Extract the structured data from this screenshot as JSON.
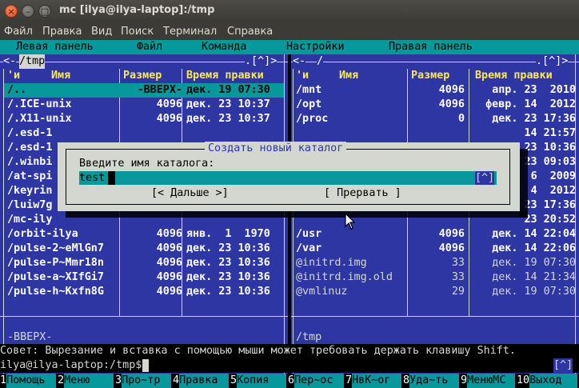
{
  "window": {
    "title": "mc [ilya@ilya-laptop]:/tmp"
  },
  "menubar": [
    "Файл",
    "Правка",
    "Вид",
    "Поиск",
    "Терминал",
    "Справка"
  ],
  "mc_menu": [
    "Левая панель",
    "Файл",
    "Команда",
    "Настройки",
    "Правая панель"
  ],
  "left_panel": {
    "path": "/tmp",
    "corner": ".[^]>",
    "sort_indicator": "'и",
    "headers": {
      "name": "Имя",
      "size": "Размер",
      "time": "Время правки"
    },
    "rows": [
      {
        "name": "/..",
        "size": "-ВВЕРХ-",
        "time": "дек. 19 07:30",
        "selected": true
      },
      {
        "name": "/.ICE-unix",
        "size": "4096",
        "time": "дек. 23 10:37"
      },
      {
        "name": "/.X11-unix",
        "size": "4096",
        "time": "дек. 23 10:37"
      },
      {
        "name": "/.esd-1",
        "size": "",
        "time": ""
      },
      {
        "name": "/.esd-1",
        "size": "",
        "time": ""
      },
      {
        "name": "/.winbi",
        "size": "",
        "time": ""
      },
      {
        "name": "/at-spi",
        "size": "",
        "time": ""
      },
      {
        "name": "/keyrin",
        "size": "",
        "time": ""
      },
      {
        "name": "/luiw7g",
        "size": "",
        "time": ""
      },
      {
        "name": "/mc-ily",
        "size": "",
        "time": ""
      },
      {
        "name": "/orbit-ilya",
        "size": "4096",
        "time": "янв.  1  1970"
      },
      {
        "name": "/pulse-2~eMlGn7",
        "size": "4096",
        "time": "дек. 23 10:36"
      },
      {
        "name": "/pulse-P~Mmr18n",
        "size": "4096",
        "time": "дек. 23 10:36"
      },
      {
        "name": "/pulse-a~XIfGi7",
        "size": "4096",
        "time": "дек. 23 10:36"
      },
      {
        "name": "/pulse-h~Kxfn8G",
        "size": "4096",
        "time": "дек. 23 10:36"
      }
    ],
    "status": "-ВВЕРХ-"
  },
  "right_panel": {
    "path": "/",
    "corner": ".[^]>",
    "sort_indicator": "'и",
    "headers": {
      "name": "Имя",
      "size": "Размер",
      "time": "Время правки"
    },
    "rows": [
      {
        "name": "/mnt",
        "size": "4096",
        "time": "апр. 23  2010"
      },
      {
        "name": "/opt",
        "size": "4096",
        "time": "февр. 14  2012"
      },
      {
        "name": "/proc",
        "size": "0",
        "time": "дек. 23 17:36"
      },
      {
        "name": "",
        "size": "",
        "time": "14 21:57"
      },
      {
        "name": "",
        "size": "",
        "time": "23 10:36"
      },
      {
        "name": "",
        "size": "",
        "time": "23 09:03"
      },
      {
        "name": "",
        "size": "",
        "time": "6  2009"
      },
      {
        "name": "",
        "size": "",
        "time": "4  2012"
      },
      {
        "name": "",
        "size": "",
        "time": "23 17:36"
      },
      {
        "name": "",
        "size": "",
        "time": "23 20:52"
      },
      {
        "name": "/usr",
        "size": "4096",
        "time": "дек. 14 22:04"
      },
      {
        "name": "/var",
        "size": "4096",
        "time": "дек. 14 22:06"
      },
      {
        "name": "@initrd.img",
        "size": "33",
        "time": "дек. 19 07:30",
        "link": true
      },
      {
        "name": "@initrd.img.old",
        "size": "33",
        "time": "дек. 14 21:34",
        "link": true
      },
      {
        "name": "@vmlinuz",
        "size": "29",
        "time": "дек. 19 07:30",
        "link": true
      }
    ],
    "status": "/tmp"
  },
  "dialog": {
    "title": "Создать новый каталог",
    "prompt": "Введите имя каталога:",
    "input_value": "test",
    "history_button": "[^]",
    "ok_button": "[< Дальше >]",
    "cancel_button": "[ Прервать ]"
  },
  "hint": "Совет: Вырезание и вставка с помощью мыши может требовать держать клавишу Shift.",
  "prompt": {
    "text": "ilya@ilya-laptop:/tmp$",
    "right_indicator": "[^]"
  },
  "fkeys": [
    {
      "n": "1",
      "label": "Помощь"
    },
    {
      "n": "2",
      "label": "Меню"
    },
    {
      "n": "3",
      "label": "Про~тр"
    },
    {
      "n": "4",
      "label": "Правка"
    },
    {
      "n": "5",
      "label": "Копия"
    },
    {
      "n": "6",
      "label": "Пер~ос"
    },
    {
      "n": "7",
      "label": "НвК~ог"
    },
    {
      "n": "8",
      "label": "Уда~ть"
    },
    {
      "n": "9",
      "label": "МенюMC"
    },
    {
      "n": "10",
      "label": "Выход"
    }
  ]
}
